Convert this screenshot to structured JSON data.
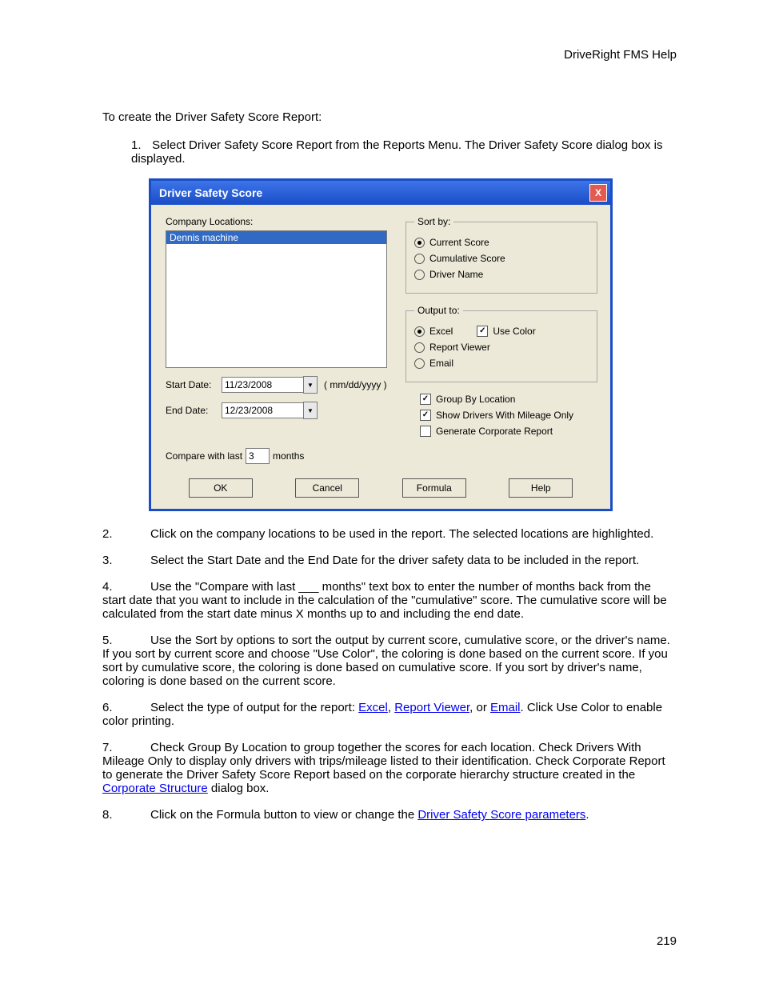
{
  "header": "DriveRight FMS Help",
  "intro": "To create the Driver Safety Score Report:",
  "list1_num": "1.",
  "list1_text": "Select Driver Safety Score Report from the Reports Menu. The Driver Safety Score dialog box is displayed.",
  "dialog": {
    "title": "Driver Safety Score",
    "company_locations_label": "Company Locations:",
    "company_location_item": "Dennis machine",
    "start_date_label": "Start Date:",
    "start_date_value": "11/23/2008",
    "date_hint": "( mm/dd/yyyy )",
    "end_date_label": "End Date:",
    "end_date_value": "12/23/2008",
    "compare_prefix": "Compare with last",
    "compare_value": "3",
    "compare_suffix": "months",
    "sort_legend": "Sort by:",
    "sort_current": "Current Score",
    "sort_cumulative": "Cumulative Score",
    "sort_driver": "Driver Name",
    "output_legend": "Output to:",
    "out_excel": "Excel",
    "use_color": "Use Color",
    "out_viewer": "Report Viewer",
    "out_email": "Email",
    "group_by": "Group By Location",
    "mileage_only": "Show Drivers With Mileage Only",
    "corp_report": "Generate Corporate Report",
    "btn_ok": "OK",
    "btn_cancel": "Cancel",
    "btn_formula": "Formula",
    "btn_help": "Help"
  },
  "s2n": "2.",
  "s2": "Click on the company locations to be used in the report. The selected locations are highlighted.",
  "s3n": "3.",
  "s3": "Select the Start Date and the End Date for the driver safety data to be included in the report.",
  "s4n": "4.",
  "s4": "Use the \"Compare with last ___ months\" text box to enter the number of months back from the start date that you want to include in the calculation of the \"cumulative\" score.  The cumulative score will be calculated from the start date minus X months up to and including the end date.",
  "s5n": "5.",
  "s5": "Use the Sort by options to sort the output by current score, cumulative score, or the driver's name.  If you sort by current score and choose \"Use Color\", the coloring is done based on the current score.  If you sort by cumulative score, the coloring is done based on cumulative score.  If you sort by driver's name, coloring is done based on the current score.",
  "s6n": "6.",
  "s6a": "Select the type of output for the report: ",
  "s6_excel": "Excel",
  "s6_c1": ", ",
  "s6_viewer": "Report Viewer",
  "s6_c2": ", or ",
  "s6_email": "Email",
  "s6b": ". Click Use Color to enable color printing.",
  "s7n": "7.",
  "s7a": "Check Group By Location to group together the scores for each location. Check Drivers With Mileage Only to display only drivers with trips/mileage listed to their identification. Check Corporate Report to generate the Driver Safety Score Report based on the corporate hierarchy structure created in the ",
  "s7_link": "Corporate Structure",
  "s7b": " dialog box.",
  "s8n": "8.",
  "s8a": "Click on the Formula button to view or change the ",
  "s8_link": "Driver Safety Score parameters",
  "s8b": ".",
  "page_num": "219"
}
